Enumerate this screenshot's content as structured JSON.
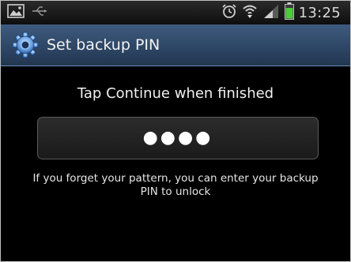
{
  "status_bar": {
    "left_icons": [
      "image-icon",
      "usb-icon"
    ],
    "right_icons": [
      "alarm-clock-icon",
      "wifi-icon",
      "signal-icon",
      "battery-icon"
    ],
    "time": "13:25"
  },
  "title_bar": {
    "icon": "gear-icon",
    "title": "Set backup PIN"
  },
  "content": {
    "instruction": "Tap Continue when finished",
    "pin_field": {
      "value": "●●●●"
    },
    "hint_line1": "If you forget your pattern, you can enter your backup",
    "hint_line2": "PIN to unlock"
  },
  "colors": {
    "title_bar": "#2e4766",
    "battery": "#4ccc3a",
    "background": "#000000"
  }
}
